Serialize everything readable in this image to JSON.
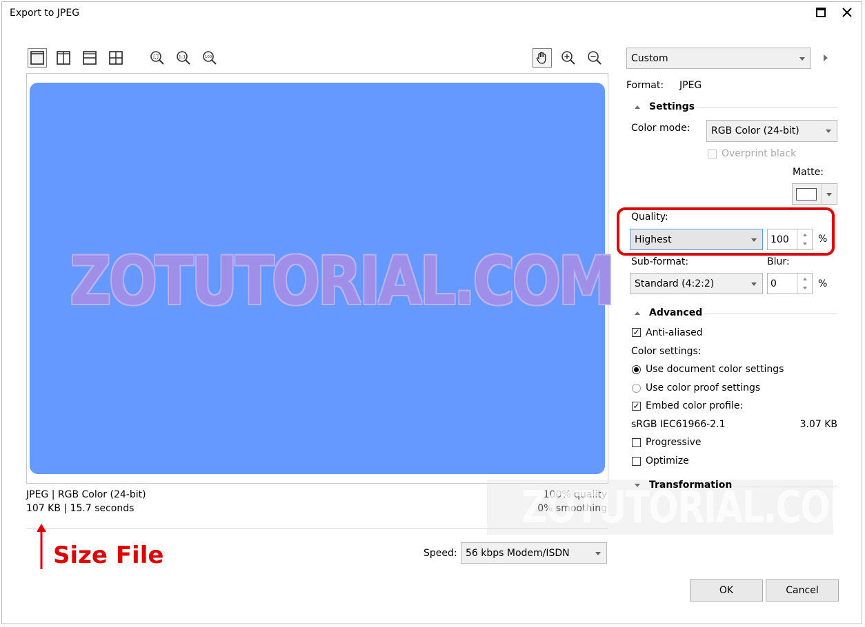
{
  "window": {
    "title": "Export to JPEG"
  },
  "preview": {
    "watermark": "ZOTUTORIAL.COM"
  },
  "status": {
    "format_line": "JPEG  |  RGB Color (24-bit)",
    "size_line": "107 KB  |  15.7 seconds",
    "quality_line": "100% quality",
    "smoothing_line": "0% smoothing"
  },
  "speed": {
    "label": "Speed:",
    "value": "56 kbps Modem/ISDN"
  },
  "annotation": {
    "text": "Size File",
    "color": "#e00000"
  },
  "panel": {
    "preset": "Custom",
    "format_label": "Format:",
    "format_value": "JPEG",
    "settings_title": "Settings",
    "color_mode_label": "Color mode:",
    "color_mode_value": "RGB Color (24-bit)",
    "overprint_black": "Overprint black",
    "matte_label": "Matte:",
    "quality_label": "Quality:",
    "quality_value": "Highest",
    "quality_percent": "100",
    "percent_sign": "%",
    "subformat_label": "Sub-format:",
    "subformat_value": "Standard (4:2:2)",
    "blur_label": "Blur:",
    "blur_value": "0",
    "advanced_title": "Advanced",
    "anti_aliased": "Anti-aliased",
    "color_settings_label": "Color settings:",
    "use_document_color": "Use document color settings",
    "use_proof_color": "Use color proof settings",
    "embed_profile": "Embed color profile:",
    "profile_name": "sRGB IEC61966-2.1",
    "profile_size": "3.07 KB",
    "progressive": "Progressive",
    "optimize": "Optimize",
    "transformation_title": "Transformation",
    "watermark": "ZOTUTORIAL.COM"
  },
  "buttons": {
    "ok": "OK",
    "cancel": "Cancel"
  },
  "colors": {
    "preview_blue": "#6699ff",
    "highlight_red": "#e00000"
  }
}
